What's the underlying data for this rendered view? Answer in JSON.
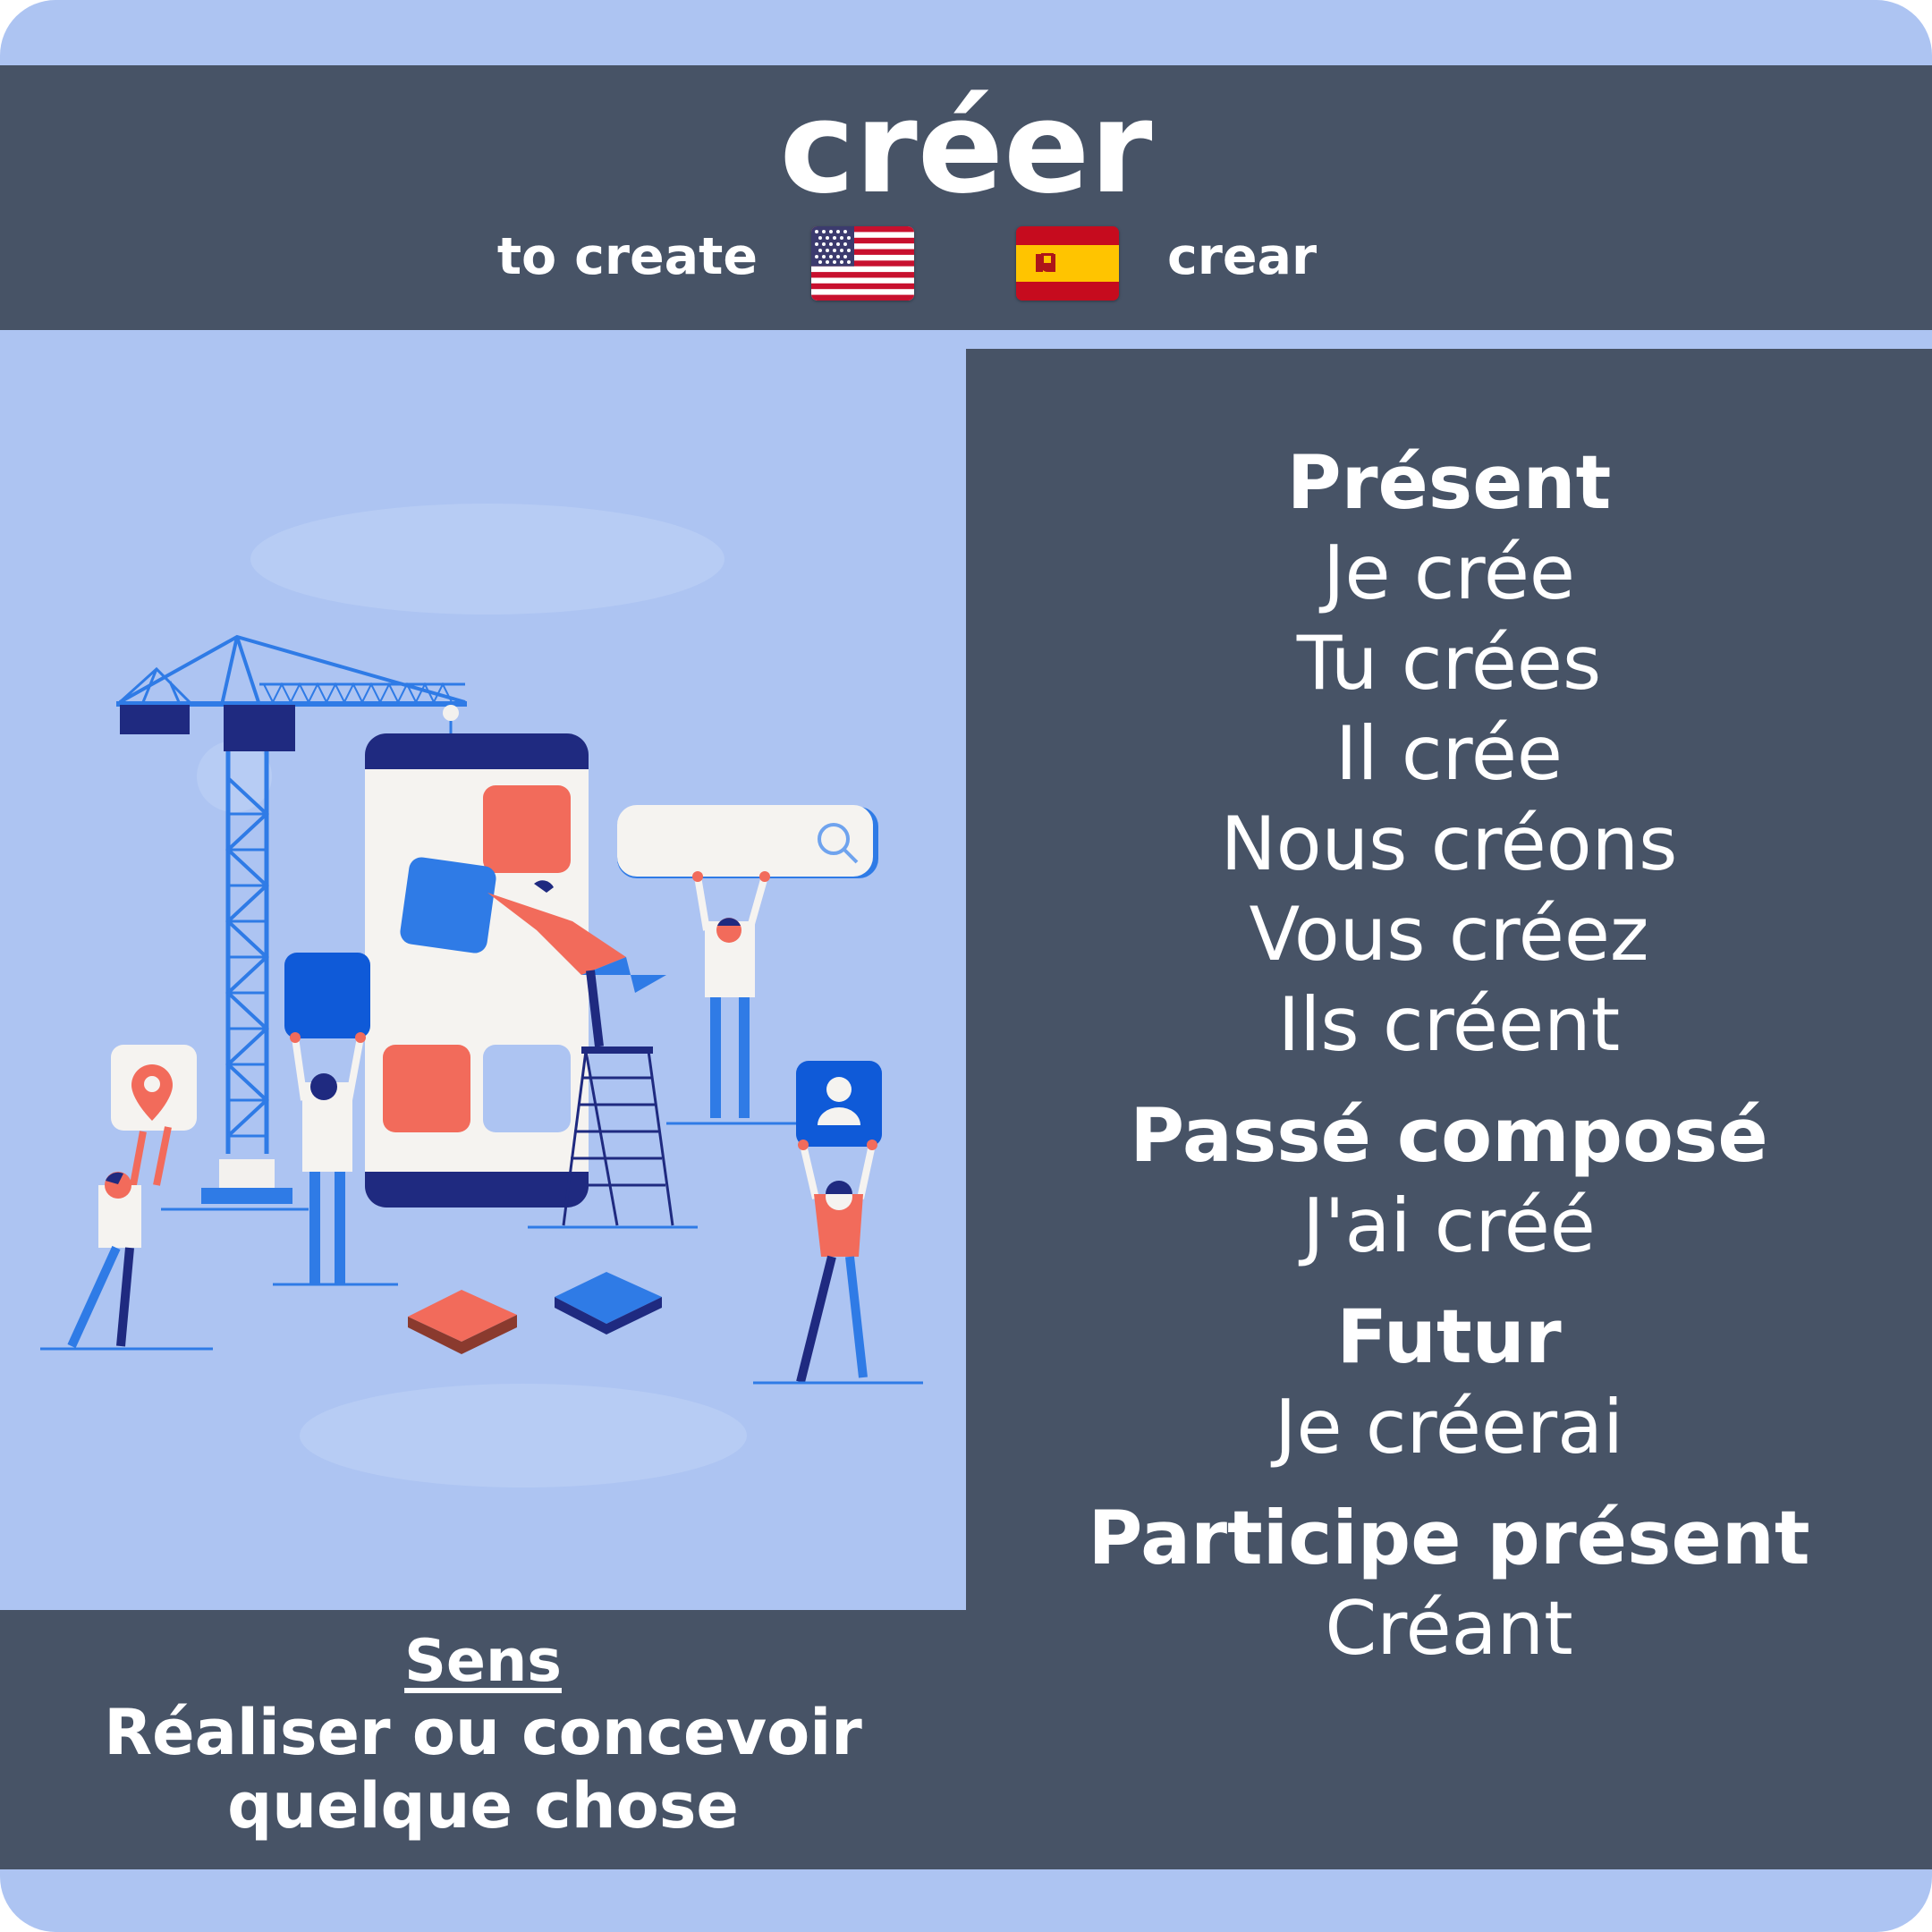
{
  "verb": "créer",
  "translations": {
    "english": "to create",
    "spanish": "crear",
    "english_flag": "us-flag",
    "spanish_flag": "spain-flag"
  },
  "conjugations": {
    "present": {
      "title": "Présent",
      "forms": [
        "Je crée",
        "Tu crées",
        "Il crée",
        "Nous créons",
        "Vous créez",
        "Ils créent"
      ]
    },
    "passe_compose": {
      "title": "Passé composé",
      "forms": [
        "J'ai créé"
      ]
    },
    "futur": {
      "title": "Futur",
      "forms": [
        "Je créerai"
      ]
    },
    "participe_present": {
      "title": "Participe présent",
      "forms": [
        "Créant"
      ]
    }
  },
  "meaning": {
    "label": "Sens",
    "text": "Réaliser ou concevoir quelque chose"
  },
  "colors": {
    "background": "#adc4f2",
    "panel": "#475366",
    "text": "#ffffff",
    "accent_blue": "#2f7be6",
    "accent_red": "#f26b5b",
    "navy": "#1f2a80"
  },
  "illustration": "construction-app-building-illustration"
}
